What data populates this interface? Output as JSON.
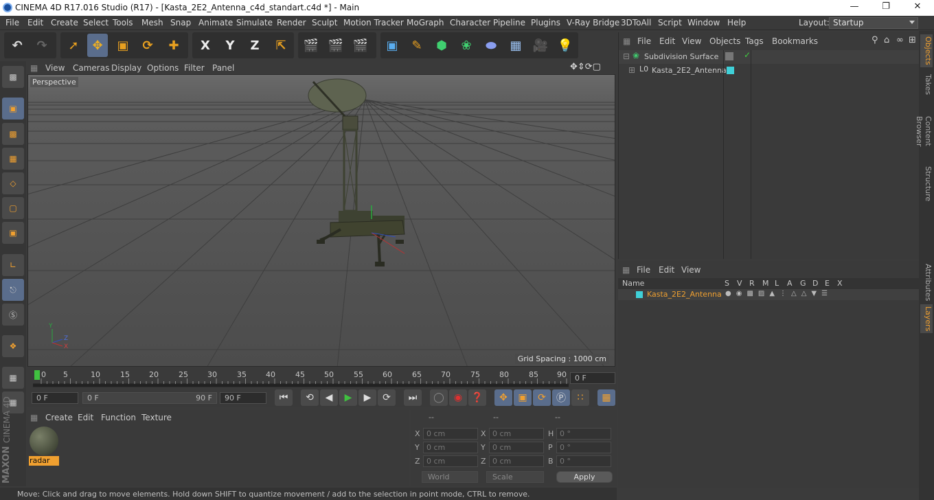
{
  "title": "CINEMA 4D R17.016 Studio (R17) - [Kasta_2E2_Antenna_c4d_standart.c4d *] - Main",
  "menu": [
    "File",
    "Edit",
    "Create",
    "Select",
    "Tools",
    "Mesh",
    "Snap",
    "Animate",
    "Simulate",
    "Render",
    "Sculpt",
    "Motion Tracker",
    "MoGraph",
    "Character",
    "Pipeline",
    "Plugins",
    "V-Ray Bridge",
    "3DToAll",
    "Script",
    "Window",
    "Help"
  ],
  "layout": {
    "label": "Layout:",
    "value": "Startup"
  },
  "viewport": {
    "menu": [
      "View",
      "Cameras",
      "Display",
      "Options",
      "Filter",
      "Panel"
    ],
    "camera": "Perspective",
    "grid_spacing": "Grid Spacing : 1000 cm",
    "axes": [
      "Y",
      "Z",
      "X"
    ]
  },
  "timeline": {
    "ticks": [
      "0",
      "5",
      "10",
      "15",
      "20",
      "25",
      "30",
      "35",
      "40",
      "45",
      "50",
      "55",
      "60",
      "65",
      "70",
      "75",
      "80",
      "85",
      "90"
    ],
    "current": "0 F",
    "start": "0 F",
    "range_start": "0 F",
    "range_end": "90 F",
    "end": "90 F"
  },
  "material_menu": [
    "Create",
    "Edit",
    "Function",
    "Texture"
  ],
  "material": {
    "name": "radar"
  },
  "coords": {
    "headers": [
      "--",
      "--",
      "--"
    ],
    "rows": [
      [
        "X",
        "0 cm",
        "X",
        "0 cm",
        "H",
        "0 °"
      ],
      [
        "Y",
        "0 cm",
        "Y",
        "0 cm",
        "P",
        "0 °"
      ],
      [
        "Z",
        "0 cm",
        "Z",
        "0 cm",
        "B",
        "0 °"
      ]
    ],
    "world": "World",
    "scale": "Scale",
    "apply": "Apply"
  },
  "objmgr": {
    "menu": [
      "File",
      "Edit",
      "View",
      "Objects",
      "Tags",
      "Bookmarks"
    ],
    "objects": [
      "Subdivision Surface",
      "Kasta_2E2_Antenna"
    ]
  },
  "layermgr": {
    "menu": [
      "File",
      "Edit",
      "View"
    ],
    "headers": [
      "Name",
      "S",
      "V",
      "R",
      "M",
      "L",
      "A",
      "G",
      "D",
      "E",
      "X"
    ],
    "layer": "Kasta_2E2_Antenna",
    "layer_color": "#3fd0d8"
  },
  "right_tabs": [
    "Objects",
    "Takes",
    "Content Browser",
    "Structure",
    "Attributes",
    "Layers"
  ],
  "status": "Move: Click and drag to move elements. Hold down SHIFT to quantize movement / add to the selection in point mode, CTRL to remove.",
  "brand": [
    "MAXON",
    "CINEMA 4D"
  ],
  "toolbar_axes": [
    "X",
    "Y",
    "Z"
  ]
}
